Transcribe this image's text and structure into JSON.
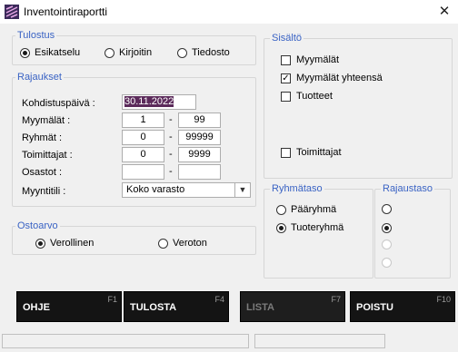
{
  "window": {
    "title": "Inventointiraportti",
    "close_glyph": "✕"
  },
  "tulostus": {
    "legend": "Tulostus",
    "options": [
      {
        "label": "Esikatselu",
        "selected": true
      },
      {
        "label": "Kirjoitin",
        "selected": false
      },
      {
        "label": "Tiedosto",
        "selected": false
      }
    ]
  },
  "rajaukset": {
    "legend": "Rajaukset",
    "kohdistuspaiva_label": "Kohdistuspäivä :",
    "kohdistuspaiva_value": "30.11.2022",
    "myymalat_label": "Myymälät :",
    "myymalat_from": "1",
    "myymalat_to": "99",
    "ryhmat_label": "Ryhmät :",
    "ryhmat_from": "0",
    "ryhmat_to": "99999",
    "toimittajat_label": "Toimittajat :",
    "toimittajat_from": "0",
    "toimittajat_to": "9999",
    "osastot_label": "Osastot :",
    "osastot_from": "",
    "osastot_to": "",
    "myyntitili_label": "Myyntitili :",
    "myyntitili_value": "Koko varasto",
    "dash": "-"
  },
  "sisalto": {
    "legend": "Sisältö",
    "items": [
      {
        "label": "Myymälät",
        "checked": false
      },
      {
        "label": "Myymälät yhteensä",
        "checked": true
      },
      {
        "label": "Tuotteet",
        "checked": false
      },
      {
        "label": "Toimittajat",
        "checked": false
      }
    ]
  },
  "ryhmataso": {
    "legend": "Ryhmätaso",
    "options": [
      {
        "label": "Pääryhmä",
        "selected": false
      },
      {
        "label": "Tuoteryhmä",
        "selected": true
      }
    ]
  },
  "rajaustaso": {
    "legend": "Rajaustaso"
  },
  "ostoarvo": {
    "legend": "Ostoarvo",
    "options": [
      {
        "label": "Verollinen",
        "selected": true
      },
      {
        "label": "Veroton",
        "selected": false
      }
    ]
  },
  "buttons": [
    {
      "label": "OHJE",
      "key": "F1",
      "enabled": true
    },
    {
      "label": "TULOSTA",
      "key": "F4",
      "enabled": true
    },
    {
      "label": "LISTA",
      "key": "F7",
      "enabled": false
    },
    {
      "label": "POISTU",
      "key": "F10",
      "enabled": true
    }
  ],
  "check_glyph": "✓"
}
